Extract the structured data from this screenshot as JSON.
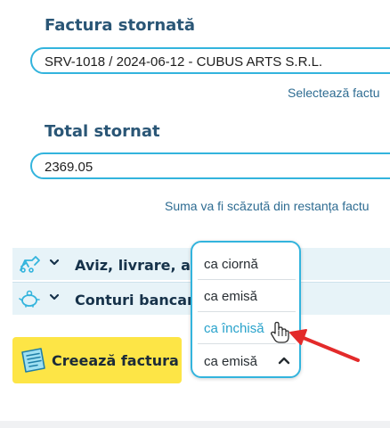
{
  "invoice": {
    "title": "Factura stornată",
    "value": "SRV-1018 / 2024-06-12 - CUBUS ARTS S.R.L.",
    "hint": "Selectează factu"
  },
  "total": {
    "title": "Total stornat",
    "value": "2369.05",
    "hint": "Suma va fi scăzută din restanța factu"
  },
  "sections": [
    {
      "label": "Aviz, livrare, ava",
      "icon": "delivery-truck-icon"
    },
    {
      "label": "Conturi bancare",
      "icon": "piggy-bank-icon"
    }
  ],
  "create_button": {
    "label": "Creează factura",
    "icon": "invoice-icon"
  },
  "status_dropdown": {
    "options": [
      "ca ciornă",
      "ca emisă",
      "ca închisă"
    ],
    "highlighted": "ca închisă",
    "selected": "ca emisă"
  },
  "colors": {
    "accent": "#33b4dd",
    "heading": "#2a5676",
    "button": "#fde546",
    "arrow": "#e32a2a"
  }
}
